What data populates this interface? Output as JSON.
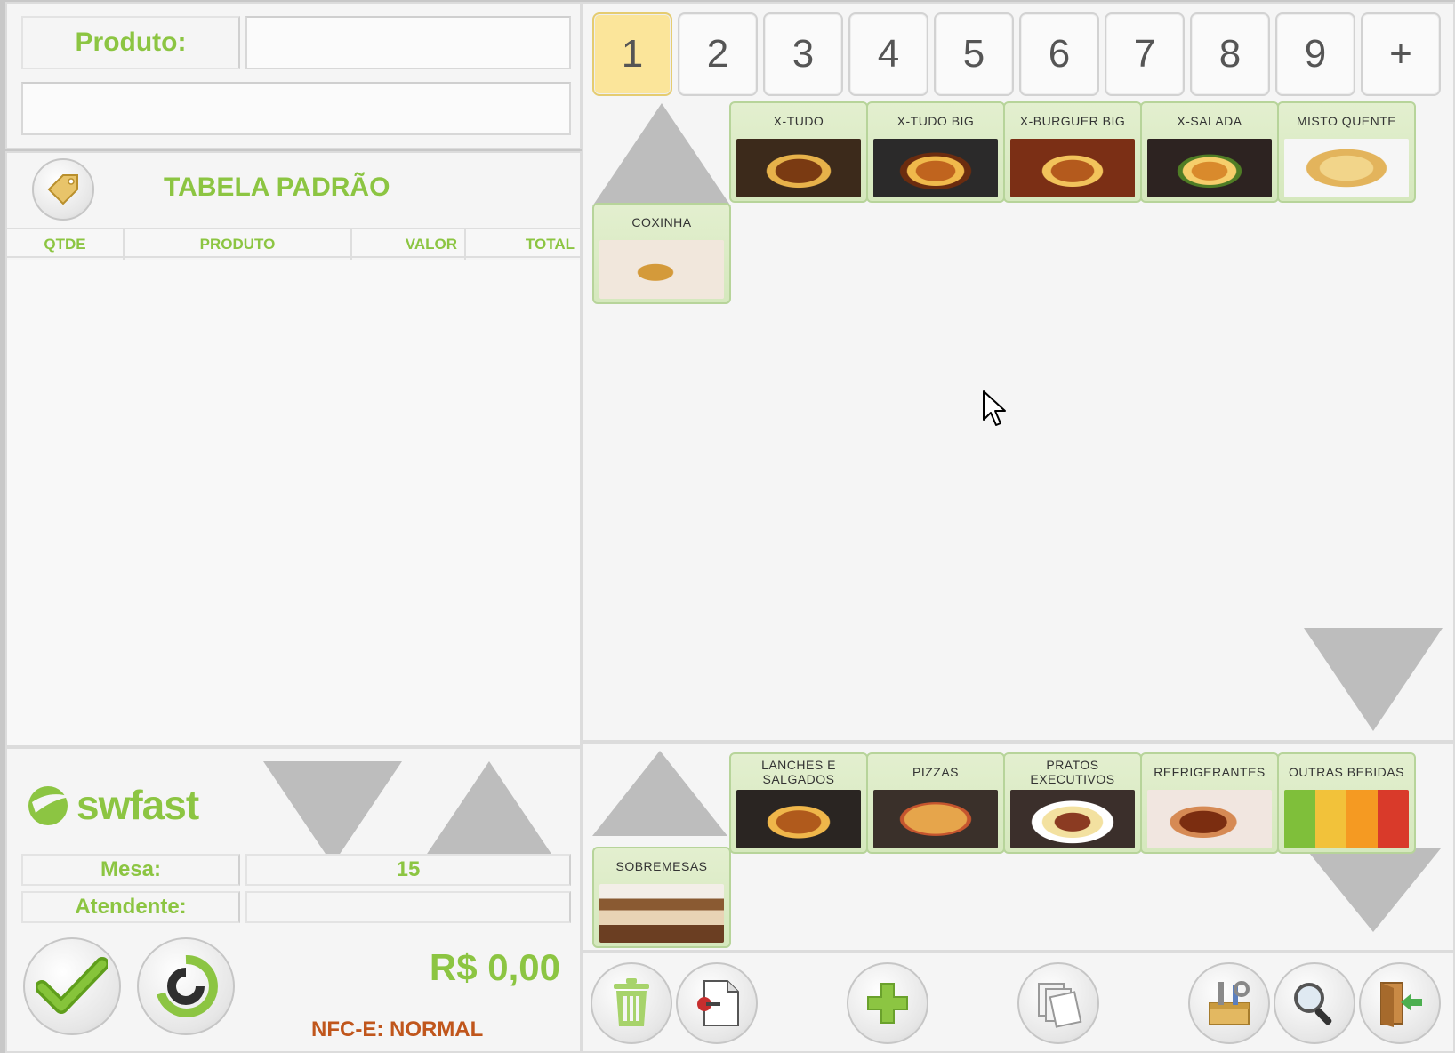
{
  "left": {
    "product_label": "Produto:",
    "product_value": "",
    "price_table": "TABELA PADRÃO",
    "columns": [
      "QTDE",
      "PRODUTO",
      "VALOR",
      "TOTAL"
    ],
    "brand": "swfast",
    "mesa_label": "Mesa:",
    "mesa_value": "15",
    "atendente_label": "Atendente:",
    "atendente_value": "",
    "total": "R$ 0,00",
    "nfce_status": "NFC-E: NORMAL"
  },
  "pages": [
    "1",
    "2",
    "3",
    "4",
    "5",
    "6",
    "7",
    "8",
    "9",
    "+"
  ],
  "active_page": "1",
  "products": [
    "X-TUDO",
    "X-TUDO BIG",
    "X-BURGUER BIG",
    "X-SALADA",
    "MISTO QUENTE",
    "COXINHA"
  ],
  "categories": [
    "LANCHES E SALGADOS",
    "PIZZAS",
    "PRATOS EXECUTIVOS",
    "REFRIGERANTES",
    "OUTRAS BEBIDAS",
    "SOBREMESAS"
  ],
  "toolbar_icons": [
    "trash-icon",
    "remove-document-icon",
    "add-icon",
    "documents-icon",
    "tools-icon",
    "search-icon",
    "exit-door-icon"
  ],
  "colors": {
    "accent": "#8cc542",
    "active_page": "#fbe59a",
    "nfce": "#c0561c",
    "tile": "#d5e8bd"
  }
}
